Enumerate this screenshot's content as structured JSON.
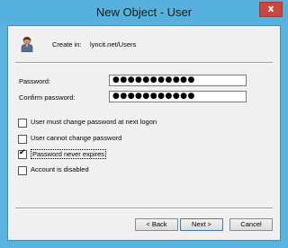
{
  "window": {
    "title": "New Object - User",
    "close_glyph": "x"
  },
  "header": {
    "create_in_label": "Create in:",
    "create_in_value": "lyncit.net/Users",
    "icon": "user-icon"
  },
  "password": {
    "label": "Password:",
    "value": "●●●●●●●●●●●"
  },
  "confirm_password": {
    "label": "Confirm password:",
    "value": "●●●●●●●●●●●"
  },
  "options": [
    {
      "label": "User must change password at next logon",
      "checked": false
    },
    {
      "label": "User cannot change password",
      "checked": false
    },
    {
      "label": "Password never expires",
      "checked": true
    },
    {
      "label": "Account is disabled",
      "checked": false
    }
  ],
  "buttons": {
    "back": "< Back",
    "next": "Next >",
    "cancel": "Cancel"
  }
}
